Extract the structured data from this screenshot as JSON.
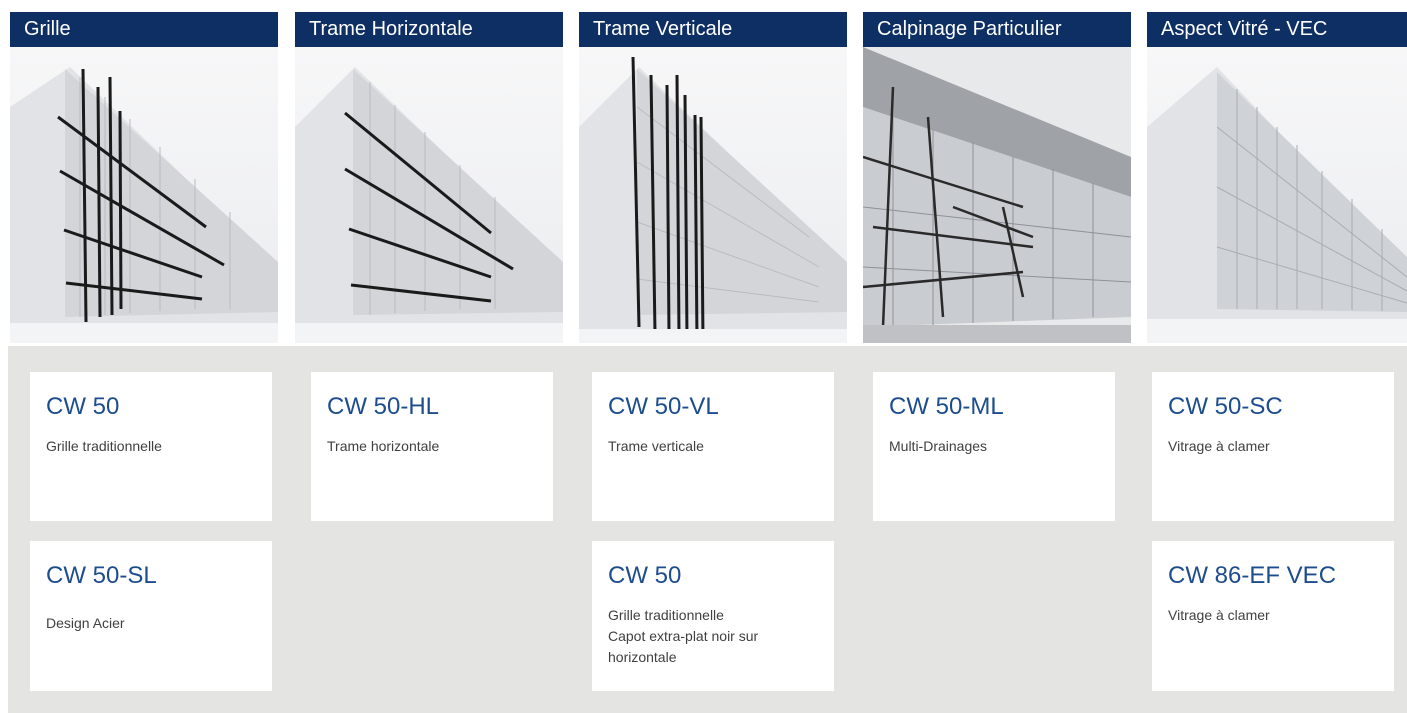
{
  "columns": [
    {
      "title": "Grille"
    },
    {
      "title": "Trame Horizontale"
    },
    {
      "title": "Trame Verticale"
    },
    {
      "title": "Calpinage Particulier"
    },
    {
      "title": "Aspect Vitré - VEC"
    }
  ],
  "cards": [
    {
      "title": "CW 50",
      "desc": "Grille traditionnelle"
    },
    {
      "title": "CW 50-SL",
      "desc": "Design Acier"
    },
    {
      "title": "CW 50-HL",
      "desc": "Trame horizontale"
    },
    {
      "title": "CW 50-VL",
      "desc": "Trame verticale"
    },
    {
      "title": "CW 50",
      "desc": "Grille traditionnelle\nCapot extra-plat noir sur\nhorizontale"
    },
    {
      "title": "CW 50-ML",
      "desc": "Multi-Drainages"
    },
    {
      "title": "CW 50-SC",
      "desc": "Vitrage à clamer"
    },
    {
      "title": "CW 86-EF VEC",
      "desc": "Vitrage à clamer"
    }
  ],
  "colors": {
    "header_bg": "#0e2f63",
    "header_text": "#ffffff",
    "card_title": "#1d4d8e",
    "panel_bg": "#e4e4e2"
  }
}
